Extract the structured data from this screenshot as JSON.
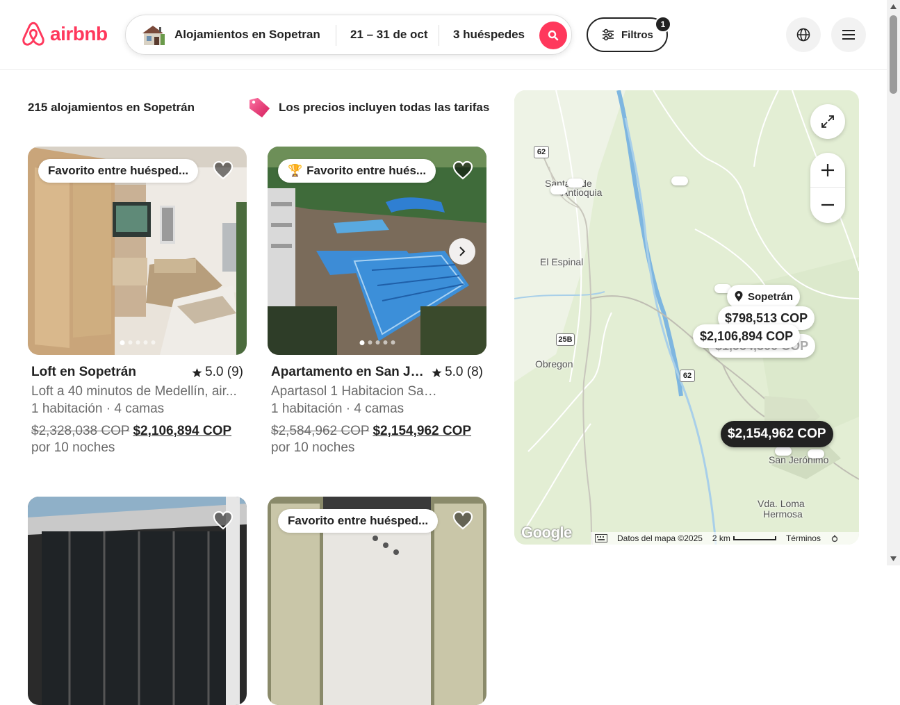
{
  "header": {
    "logo_text": "airbnb",
    "search": {
      "location": "Alojamientos en Sopetran",
      "dates": "21 – 31 de oct",
      "guests": "3 huéspedes"
    },
    "filters": {
      "label": "Filtros",
      "badge": "1"
    }
  },
  "results": {
    "count_label": "215 alojamientos en Sopetrán",
    "price_note": "Los precios incluyen todas las tarifas"
  },
  "listings": [
    {
      "badge": "Favorito entre huésped...",
      "title": "Loft en Sopetrán",
      "rating": "5.0 (9)",
      "subtitle": "Loft a 40 minutos de Medellín, air...",
      "beds": "1 habitación · 4 camas",
      "old_price": "$2,328,038 COP",
      "new_price": "$2,106,894 COP",
      "nights": "por 10 noches"
    },
    {
      "badge": "Favorito entre hués...",
      "title": "Apartamento en San Je...",
      "rating": "5.0 (8)",
      "subtitle": "Apartasol 1 Habitacion San...",
      "beds": "1 habitación · 4 camas",
      "old_price": "$2,584,962 COP",
      "new_price": "$2,154,962 COP",
      "nights": "por 10 noches"
    },
    {
      "badge": ""
    },
    {
      "badge": "Favorito entre huésped..."
    }
  ],
  "map": {
    "labels": {
      "santafe": "Santa Fé de Antioquia",
      "santafe_short": "Santafé de",
      "antioquia": "Antioquia",
      "espinal": "El Espinal",
      "obregon": "Obregon",
      "sanjeronimo": "San Jerónimo",
      "loma1": "Vda. Loma",
      "loma2": "Hermosa",
      "road62": "62",
      "road25b": "25B"
    },
    "pin_label": "Sopetrán",
    "prices": {
      "p1": "$798,513 COP",
      "p2": "$2,106,894 COP",
      "p3": "$1,954,300 COP",
      "selected": "$2,154,962 COP"
    },
    "footer": {
      "google": "Google",
      "data": "Datos del mapa ©2025",
      "scale": "2 km",
      "terms": "Términos"
    }
  }
}
